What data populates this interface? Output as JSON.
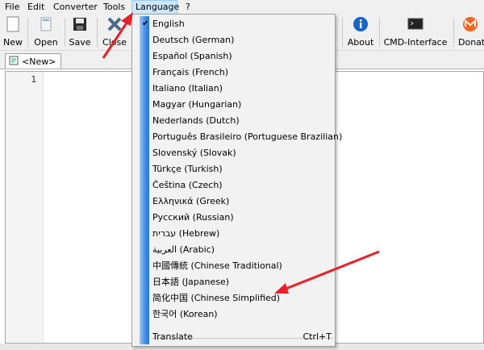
{
  "menubar": {
    "items": [
      "File",
      "Edit",
      "Converter",
      "Tools",
      "Language",
      "?"
    ]
  },
  "toolbar": {
    "new": "New",
    "open": "Open",
    "save": "Save",
    "close": "Close",
    "about": "About",
    "cmd": "CMD-Interface",
    "donate": "Donat"
  },
  "tabs": [
    {
      "label": "<New>"
    }
  ],
  "editor": {
    "line_number": "1"
  },
  "language_menu": {
    "items": [
      "English",
      "Deutsch (German)",
      "Español (Spanish)",
      "Français (French)",
      "Italiano (Italian)",
      "Magyar (Hungarian)",
      "Nederlands (Dutch)",
      "Português Brasileiro (Portuguese Brazilian)",
      "Slovenský (Slovak)",
      "Türkçe (Turkish)",
      "Čeština (Czech)",
      "Ελληνικά (Greek)",
      "Русский (Russian)",
      "עברית (Hebrew)",
      "العربية (Arabic)",
      "中國傳統 (Chinese Traditional)",
      "日本語 (Japanese)",
      "简化中国 (Chinese Simplified)",
      "한국어 (Korean)"
    ],
    "checked": "English",
    "translate_label": "Translate",
    "translate_shortcut": "Ctrl+T"
  },
  "colors": {
    "arrow": "#e8202a",
    "menu_strip": "#3f8de6",
    "active_menu": "#cce8ff"
  }
}
